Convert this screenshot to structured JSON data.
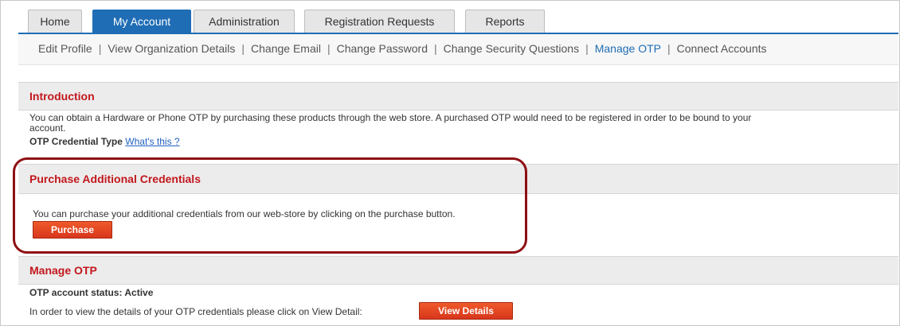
{
  "tabs": [
    {
      "label": "Home",
      "active": false
    },
    {
      "label": "My Account",
      "active": true
    },
    {
      "label": "Administration",
      "active": false
    },
    {
      "label": "Registration Requests",
      "active": false
    },
    {
      "label": "Reports",
      "active": false
    }
  ],
  "subnav": {
    "items": [
      "Edit Profile",
      "View Organization Details",
      "Change Email",
      "Change Password",
      "Change Security Questions",
      "Manage OTP",
      "Connect Accounts"
    ],
    "current": "Manage OTP",
    "separator": "|"
  },
  "introduction": {
    "title": "Introduction",
    "text_line1": "You can obtain a Hardware or Phone OTP by purchasing these products through the web store. A purchased OTP would need to be registered in order to be bound to your",
    "text_line2": "account.",
    "credential_type_label": "OTP Credential Type",
    "whats_this_link": "What's this ?"
  },
  "purchase": {
    "title": "Purchase Additional Credentials",
    "text": "You can purchase your additional credentials from our web-store by clicking on the purchase button.",
    "button_label": "Purchase"
  },
  "manage_otp": {
    "title": "Manage OTP",
    "status_text": "OTP account status: Active",
    "detail_text": "In order to view the details of your OTP credentials please click on View Detail:",
    "button_label": "View Details"
  },
  "colors": {
    "tab_active": "#1f6db5",
    "section_title": "#c2171d",
    "button": "#e04a22",
    "highlight_outline": "#8e0f14"
  }
}
